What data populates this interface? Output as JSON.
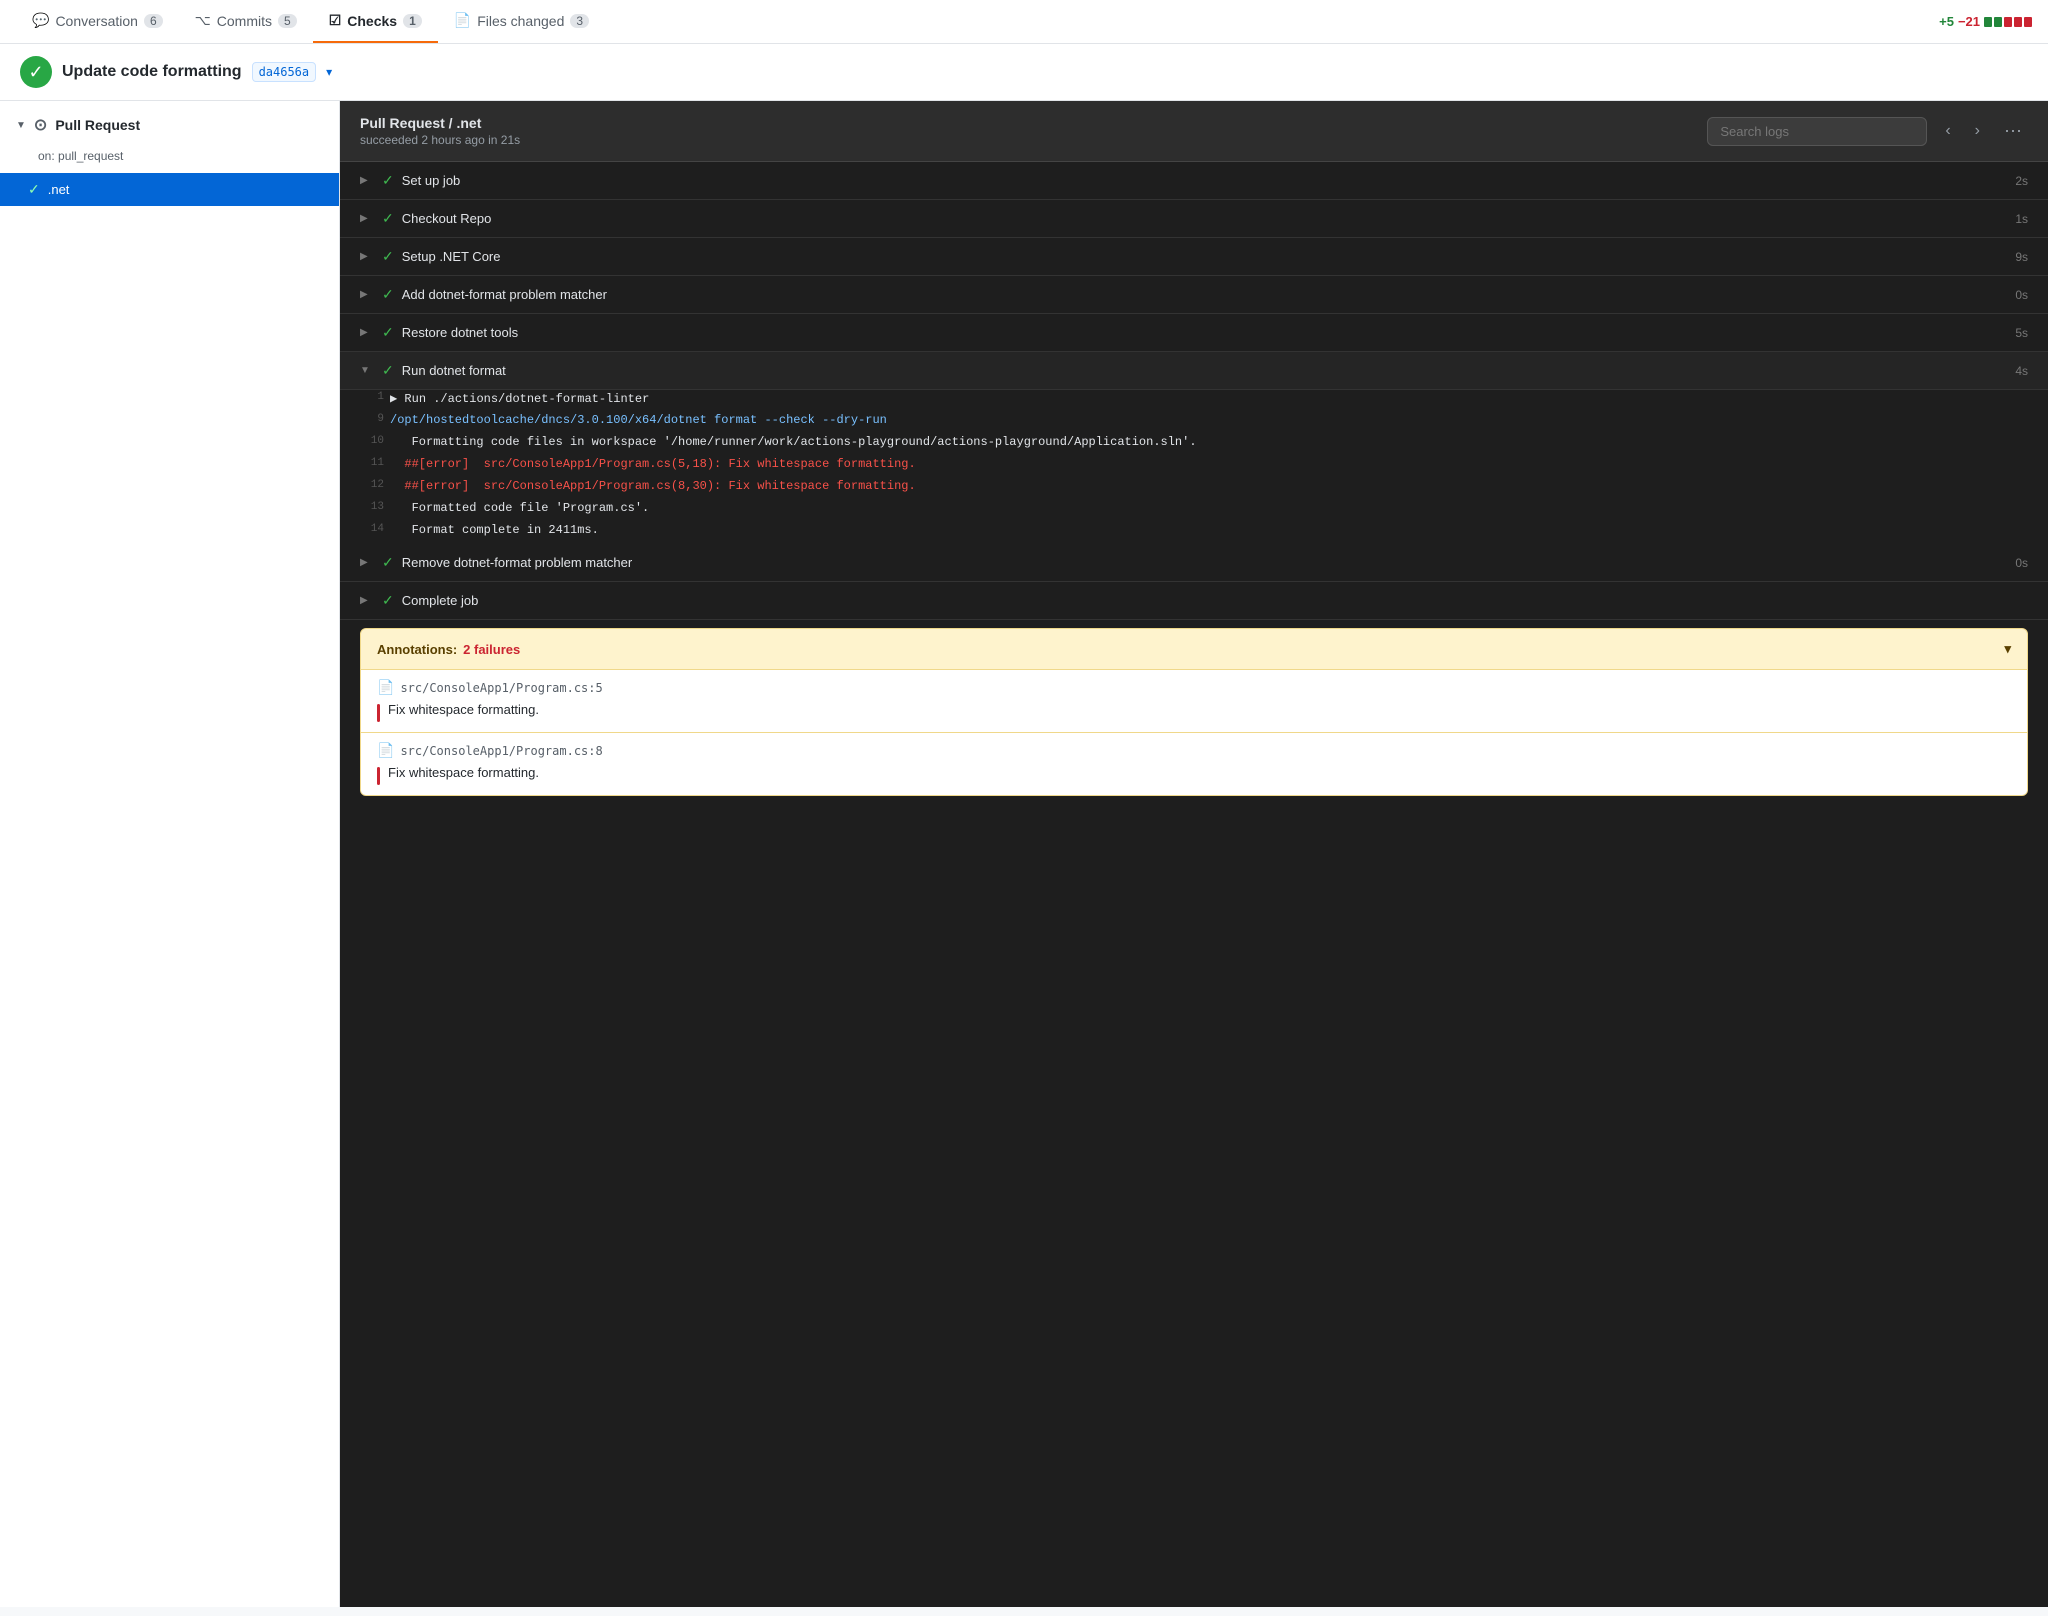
{
  "tabs": [
    {
      "id": "conversation",
      "label": "Conversation",
      "badge": "6",
      "icon": "💬",
      "active": false
    },
    {
      "id": "commits",
      "label": "Commits",
      "badge": "5",
      "icon": "⌥",
      "active": false
    },
    {
      "id": "checks",
      "label": "Checks",
      "badge": "1",
      "icon": "☑",
      "active": true
    },
    {
      "id": "files-changed",
      "label": "Files changed",
      "badge": "3",
      "icon": "📄",
      "active": false
    }
  ],
  "diff_stats": {
    "add": "+5",
    "remove": "−21",
    "bars": [
      "add",
      "add",
      "remove",
      "remove",
      "remove"
    ]
  },
  "commit": {
    "title": "Update code formatting",
    "hash": "da4656a",
    "icon": "✓"
  },
  "sidebar": {
    "workflow_label": "Pull Request",
    "workflow_sub": "on: pull_request",
    "items": [
      {
        "id": "net",
        "label": ".net",
        "active": true,
        "check": true
      }
    ]
  },
  "content": {
    "breadcrumb": "Pull Request / .net",
    "subtitle": "succeeded 2 hours ago in 21s",
    "search_placeholder": "Search logs",
    "steps": [
      {
        "id": "setup-job",
        "label": "Set up job",
        "time": "2s",
        "expanded": false,
        "check": true
      },
      {
        "id": "checkout-repo",
        "label": "Checkout Repo",
        "time": "1s",
        "expanded": false,
        "check": true
      },
      {
        "id": "setup-net-core",
        "label": "Setup .NET Core",
        "time": "9s",
        "expanded": false,
        "check": true
      },
      {
        "id": "add-matcher",
        "label": "Add dotnet-format problem matcher",
        "time": "0s",
        "expanded": false,
        "check": true
      },
      {
        "id": "restore-tools",
        "label": "Restore dotnet tools",
        "time": "5s",
        "expanded": false,
        "check": true
      },
      {
        "id": "run-format",
        "label": "Run dotnet format",
        "time": "4s",
        "expanded": true,
        "check": true
      },
      {
        "id": "remove-matcher",
        "label": "Remove dotnet-format problem matcher",
        "time": "0s",
        "expanded": false,
        "check": true
      },
      {
        "id": "complete-job",
        "label": "Complete job",
        "time": "",
        "expanded": false,
        "check": true
      }
    ],
    "log_lines": [
      {
        "num": "1",
        "text": "▶ Run ./actions/dotnet-format-linter",
        "style": "white"
      },
      {
        "num": "9",
        "text": "/opt/hostedtoolcache/dncs/3.0.100/x64/dotnet format --check --dry-run",
        "style": "cyan"
      },
      {
        "num": "10",
        "text": "   Formatting code files in workspace '/home/runner/work/actions-playground/actions-\n   playground/Application.sln'.",
        "style": "white"
      },
      {
        "num": "11",
        "text": "##[error]  src/ConsoleApp1/Program.cs(5,18): Fix whitespace formatting.",
        "style": "red"
      },
      {
        "num": "12",
        "text": "##[error]  src/ConsoleApp1/Program.cs(8,30): Fix whitespace formatting.",
        "style": "red"
      },
      {
        "num": "13",
        "text": "   Formatted code file 'Program.cs'.",
        "style": "white"
      },
      {
        "num": "14",
        "text": "   Format complete in 2411ms.",
        "style": "white"
      }
    ],
    "annotations": {
      "label": "Annotations:",
      "count_label": "2 failures",
      "items": [
        {
          "file": "src/ConsoleApp1/Program.cs:5",
          "message": "Fix whitespace formatting."
        },
        {
          "file": "src/ConsoleApp1/Program.cs:8",
          "message": "Fix whitespace formatting."
        }
      ]
    }
  }
}
